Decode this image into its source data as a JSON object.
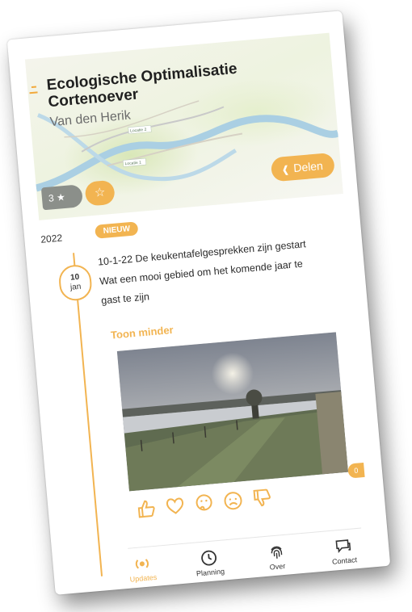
{
  "project": {
    "title_line1": "Ecologische Optimalisatie",
    "title_line2": "Cortenoever",
    "subtitle": "Van den Herik",
    "rating_count": "3",
    "share_label": "Delen",
    "map_labels": [
      "Locatie 2",
      "Locatie 1"
    ]
  },
  "timeline": {
    "year": "2022",
    "date_day": "10",
    "date_month": "jan"
  },
  "post": {
    "badge": "NIEUW",
    "line1": "10-1-22 De keukentafelgesprekken zijn gestart",
    "line2": "Wat een mooi gebied om het komende jaar te",
    "line3": "gast te zijn",
    "toggle_label": "Toon minder",
    "comment_count": "0",
    "reactions": [
      "thumbs-up-icon",
      "heart-icon",
      "thinking-icon",
      "sad-icon",
      "thumbs-down-icon"
    ]
  },
  "nav": {
    "items": [
      {
        "label": "Updates",
        "icon": "broadcast-icon"
      },
      {
        "label": "Planning",
        "icon": "clock-icon"
      },
      {
        "label": "Over",
        "icon": "fingerprint-icon"
      },
      {
        "label": "Contact",
        "icon": "chat-icon"
      }
    ]
  },
  "colors": {
    "accent": "#f2b451",
    "text": "#1f1f1f",
    "muted": "#6b6b6b",
    "badge_grey": "#8b8f8a"
  }
}
